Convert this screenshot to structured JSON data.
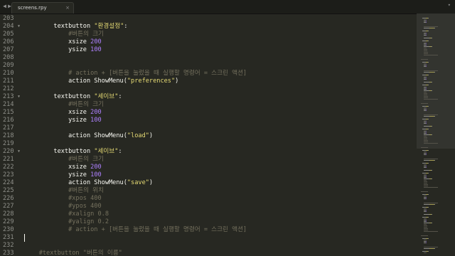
{
  "window": {
    "title_fragment": "y"
  },
  "tabbar": {
    "back_glyph": "◀",
    "forward_glyph": "▶",
    "tab": {
      "label": "screens.rpy",
      "close_glyph": "×",
      "icon": "close-icon"
    },
    "dropdown_glyph": "▾"
  },
  "editor": {
    "colors": {
      "background": "#272822",
      "text": "#f8f8f2",
      "string": "#e6db74",
      "number": "#ae81ff",
      "comment": "#75715e",
      "gutter": "#8f908a"
    },
    "lines": [
      {
        "n": "203",
        "fold": false,
        "tokens": []
      },
      {
        "n": "204",
        "fold": true,
        "tokens": [
          {
            "t": "kw",
            "v": "        textbutton "
          },
          {
            "t": "str",
            "v": "\"환경설정\""
          },
          {
            "t": "kw",
            "v": ":"
          }
        ]
      },
      {
        "n": "205",
        "fold": false,
        "tokens": [
          {
            "t": "cm",
            "v": "            #버튼의 크기"
          }
        ]
      },
      {
        "n": "206",
        "fold": false,
        "tokens": [
          {
            "t": "kw",
            "v": "            xsize "
          },
          {
            "t": "num",
            "v": "200"
          }
        ]
      },
      {
        "n": "207",
        "fold": false,
        "tokens": [
          {
            "t": "kw",
            "v": "            ysize "
          },
          {
            "t": "num",
            "v": "100"
          }
        ]
      },
      {
        "n": "208",
        "fold": false,
        "tokens": []
      },
      {
        "n": "209",
        "fold": false,
        "tokens": []
      },
      {
        "n": "210",
        "fold": false,
        "tokens": [
          {
            "t": "cm",
            "v": "            # action + [버튼을 눌렀을 때 실행할 명령어 = 스크린 액션]"
          }
        ]
      },
      {
        "n": "211",
        "fold": false,
        "tokens": [
          {
            "t": "kw",
            "v": "            action ShowMenu("
          },
          {
            "t": "str",
            "v": "\"preferences\""
          },
          {
            "t": "kw",
            "v": ")"
          }
        ]
      },
      {
        "n": "212",
        "fold": false,
        "tokens": []
      },
      {
        "n": "213",
        "fold": true,
        "tokens": [
          {
            "t": "kw",
            "v": "        textbutton "
          },
          {
            "t": "str",
            "v": "\"세이브\""
          },
          {
            "t": "kw",
            "v": ":"
          }
        ]
      },
      {
        "n": "214",
        "fold": false,
        "tokens": [
          {
            "t": "cm",
            "v": "            #버튼의 크기"
          }
        ]
      },
      {
        "n": "215",
        "fold": false,
        "tokens": [
          {
            "t": "kw",
            "v": "            xsize "
          },
          {
            "t": "num",
            "v": "200"
          }
        ]
      },
      {
        "n": "216",
        "fold": false,
        "tokens": [
          {
            "t": "kw",
            "v": "            ysize "
          },
          {
            "t": "num",
            "v": "100"
          }
        ]
      },
      {
        "n": "217",
        "fold": false,
        "tokens": []
      },
      {
        "n": "218",
        "fold": false,
        "tokens": [
          {
            "t": "kw",
            "v": "            action ShowMenu("
          },
          {
            "t": "str",
            "v": "\"load\""
          },
          {
            "t": "kw",
            "v": ")"
          }
        ]
      },
      {
        "n": "219",
        "fold": false,
        "tokens": []
      },
      {
        "n": "220",
        "fold": true,
        "tokens": [
          {
            "t": "kw",
            "v": "        textbutton "
          },
          {
            "t": "str",
            "v": "\"세이브\""
          },
          {
            "t": "kw",
            "v": ":"
          }
        ]
      },
      {
        "n": "221",
        "fold": false,
        "tokens": [
          {
            "t": "cm",
            "v": "            #버튼의 크기"
          }
        ]
      },
      {
        "n": "222",
        "fold": false,
        "tokens": [
          {
            "t": "kw",
            "v": "            xsize "
          },
          {
            "t": "num",
            "v": "200"
          }
        ]
      },
      {
        "n": "223",
        "fold": false,
        "tokens": [
          {
            "t": "kw",
            "v": "            ysize "
          },
          {
            "t": "num",
            "v": "100"
          }
        ]
      },
      {
        "n": "224",
        "fold": false,
        "tokens": [
          {
            "t": "kw",
            "v": "            action ShowMenu("
          },
          {
            "t": "str",
            "v": "\"save\""
          },
          {
            "t": "kw",
            "v": ")"
          }
        ]
      },
      {
        "n": "225",
        "fold": false,
        "tokens": [
          {
            "t": "cm",
            "v": "            #버튼의 위치"
          }
        ]
      },
      {
        "n": "226",
        "fold": false,
        "tokens": [
          {
            "t": "cm",
            "v": "            #xpos 400"
          }
        ]
      },
      {
        "n": "227",
        "fold": false,
        "tokens": [
          {
            "t": "cm",
            "v": "            #ypos 400"
          }
        ]
      },
      {
        "n": "228",
        "fold": false,
        "tokens": [
          {
            "t": "cm",
            "v": "            #xalign 0.8"
          }
        ]
      },
      {
        "n": "229",
        "fold": false,
        "tokens": [
          {
            "t": "cm",
            "v": "            #yalign 0.2"
          }
        ]
      },
      {
        "n": "230",
        "fold": false,
        "tokens": [
          {
            "t": "cm",
            "v": "            # action + [버튼을 눌렀을 때 실행할 명령어 = 스크린 액션]"
          }
        ]
      },
      {
        "n": "231",
        "fold": false,
        "tokens": [],
        "caret": true
      },
      {
        "n": "232",
        "fold": false,
        "tokens": []
      },
      {
        "n": "233",
        "fold": false,
        "tokens": [
          {
            "t": "cm",
            "v": "    #textbutton \"버튼의 이름\""
          }
        ]
      }
    ]
  }
}
